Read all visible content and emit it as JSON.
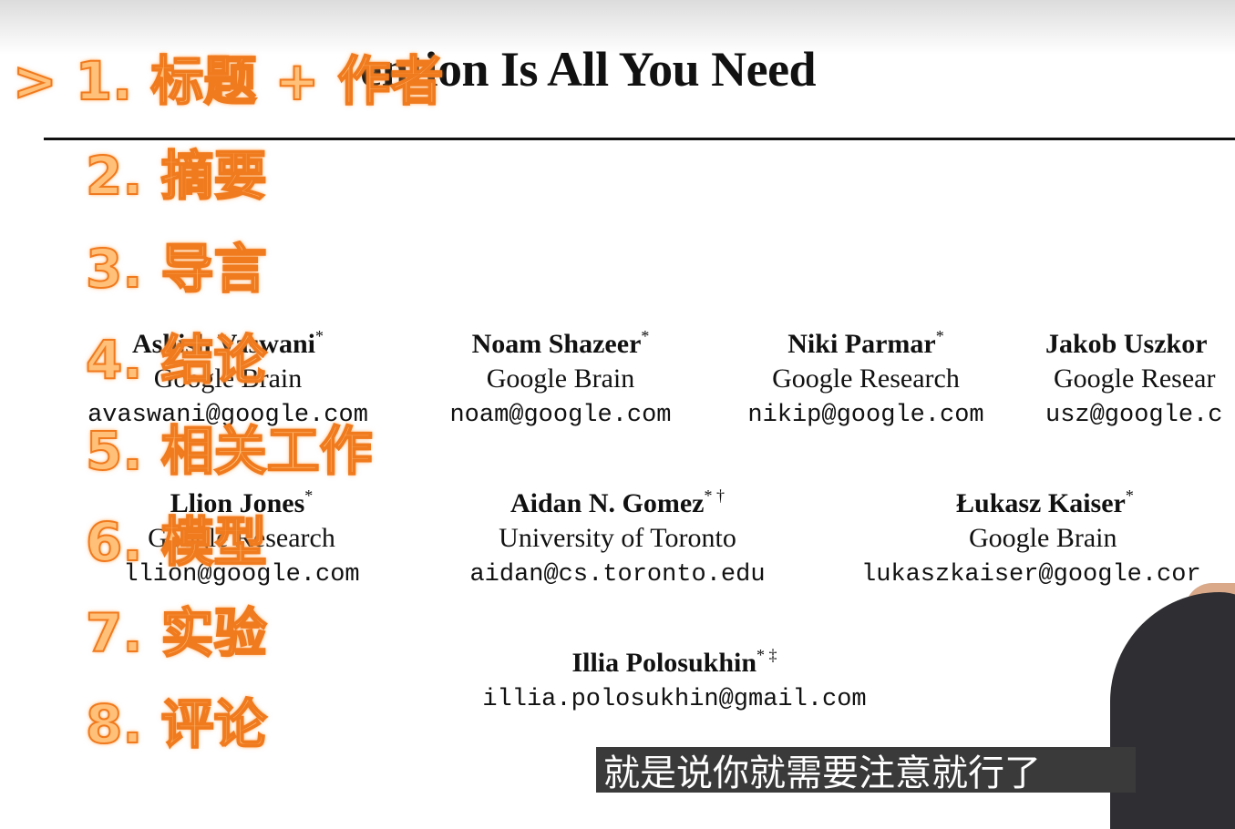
{
  "paper": {
    "title": "ention Is All You Need",
    "authors": [
      {
        "name": "Ashish Vaswani",
        "mark": "*",
        "affiliation": "Google Brain",
        "email": "avaswani@google.com"
      },
      {
        "name": "Noam Shazeer",
        "mark": "*",
        "affiliation": "Google Brain",
        "email": "noam@google.com"
      },
      {
        "name": "Niki Parmar",
        "mark": "*",
        "affiliation": "Google Research",
        "email": "nikip@google.com"
      },
      {
        "name": "Jakob Uszkor",
        "mark": "",
        "affiliation": "Google Resear",
        "email": "usz@google.c"
      },
      {
        "name": "Llion Jones",
        "mark": "*",
        "affiliation": "Google Research",
        "email": "llion@google.com"
      },
      {
        "name": "Aidan N. Gomez",
        "mark": "* †",
        "affiliation": "University of Toronto",
        "email": "aidan@cs.toronto.edu"
      },
      {
        "name": "Łukasz Kaiser",
        "mark": "*",
        "affiliation": "Google Brain",
        "email": "lukaszkaiser@google.cor"
      },
      {
        "name": "Illia Polosukhin",
        "mark": "* ‡",
        "affiliation": "",
        "email": "illia.polosukhin@gmail.com"
      }
    ]
  },
  "outline": {
    "items": [
      "> 1. 标题 + 作者",
      "2. 摘要",
      "3. 导言",
      "4. 结论",
      "5. 相关工作",
      "6. 模型",
      "7. 实验",
      "8. 评论"
    ]
  },
  "subtitle": {
    "text": "就是说你就需要注意就行了"
  }
}
